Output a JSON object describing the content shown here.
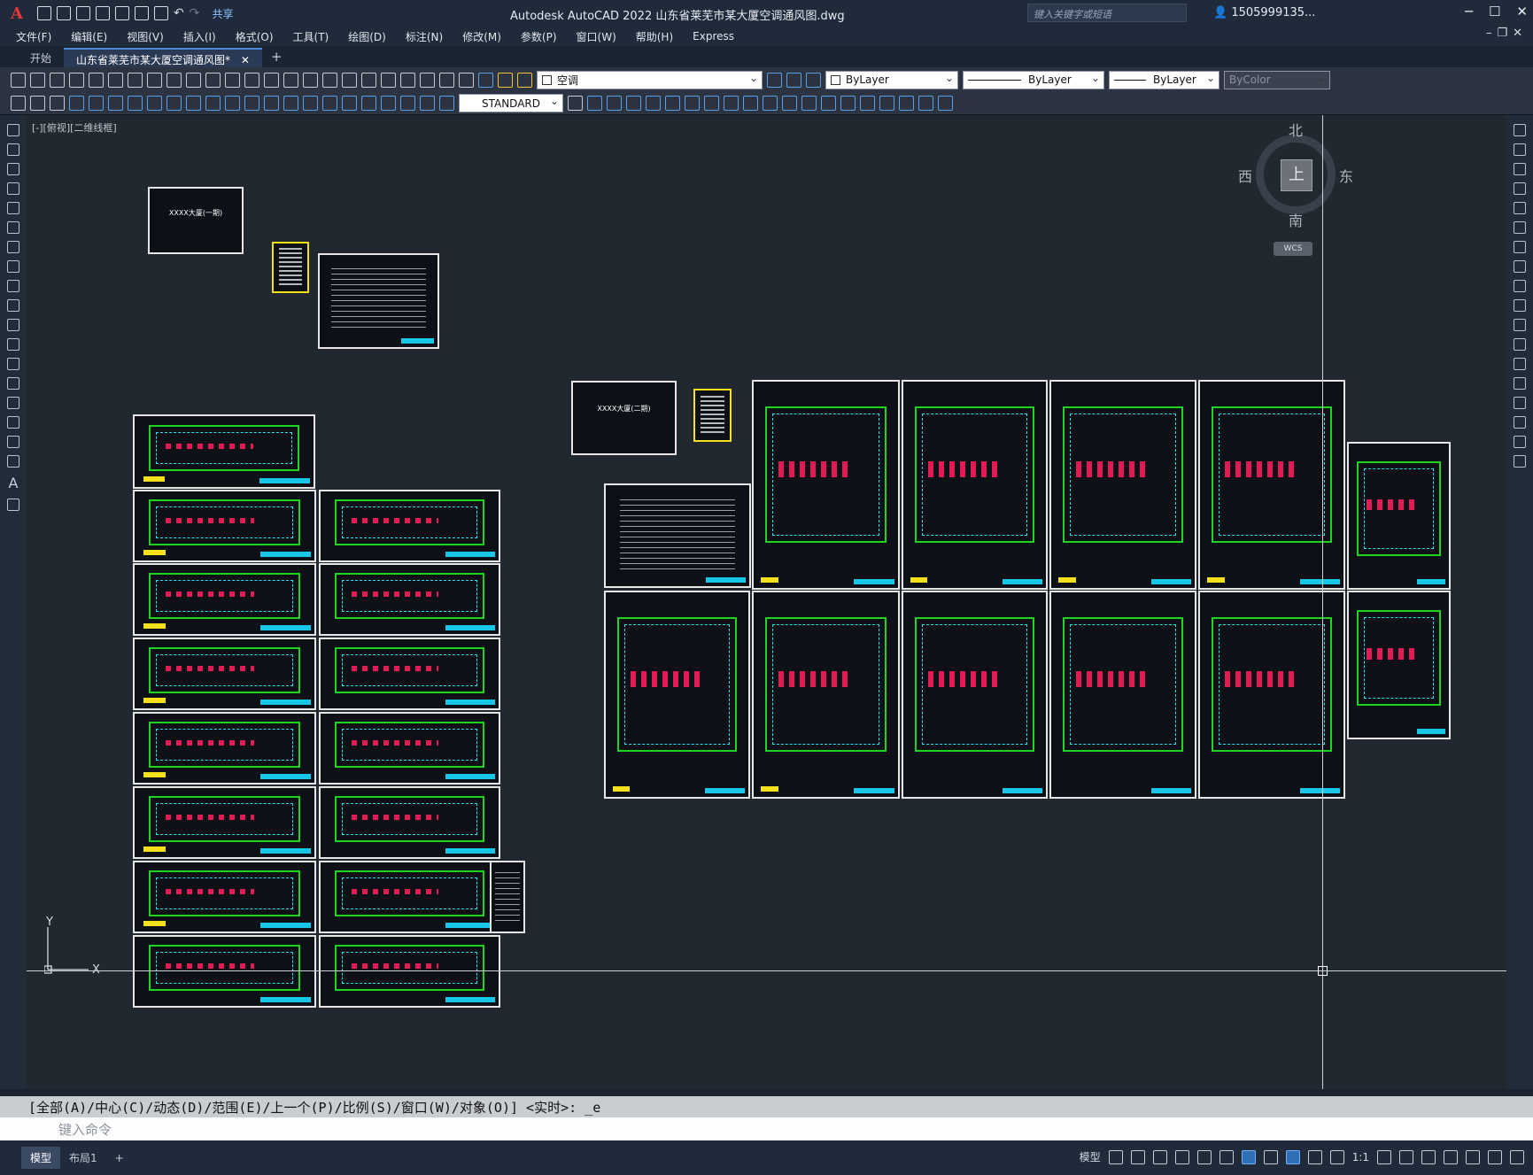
{
  "app": {
    "title": "Autodesk AutoCAD 2022    山东省莱芜市某大厦空调通风图.dwg",
    "share_label": "共享",
    "search_placeholder": "键入关键字或短语",
    "user": "1505999135..."
  },
  "menu": [
    "文件(F)",
    "编辑(E)",
    "视图(V)",
    "插入(I)",
    "格式(O)",
    "工具(T)",
    "绘图(D)",
    "标注(N)",
    "修改(M)",
    "参数(P)",
    "窗口(W)",
    "帮助(H)",
    "Express"
  ],
  "tabs": {
    "start": "开始",
    "file": "山东省莱芜市某大厦空调通风图*"
  },
  "toolbar": {
    "layer_value": "空调",
    "color_value": "ByLayer",
    "linetype_value": "ByLayer",
    "lineweight_value": "ByLayer",
    "plotstyle_value": "ByColor",
    "textstyle_value": "STANDARD"
  },
  "viewport": {
    "label": "[-][俯视][二维线框]",
    "compass": {
      "north": "北",
      "south": "南",
      "east": "东",
      "west": "西",
      "face": "上"
    },
    "wcs": "WCS",
    "ucs_x": "X",
    "ucs_y": "Y"
  },
  "sheets": {
    "cover1": "XXXX大厦(一期)",
    "cover2": "XXXX大厦(二期)"
  },
  "command": {
    "history": "[全部(A)/中心(C)/动态(D)/范围(E)/上一个(P)/比例(S)/窗口(W)/对象(O)] <实时>: _e",
    "placeholder": "键入命令"
  },
  "status": {
    "tabs": [
      "模型",
      "布局1"
    ],
    "model_label": "模型",
    "scale": "1:1"
  }
}
